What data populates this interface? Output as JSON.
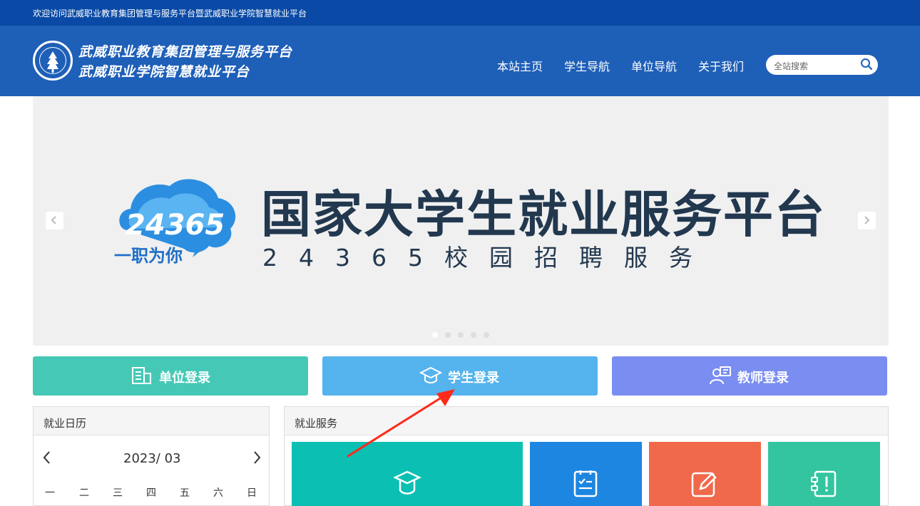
{
  "topbar": {
    "welcome": "欢迎访问武威职业教育集团管理与服务平台暨武威职业学院智慧就业平台"
  },
  "header": {
    "title_line1": "武威职业教育集团管理与服务平台",
    "title_line2": "武威职业学院智慧就业平台",
    "nav": [
      "本站主页",
      "学生导航",
      "单位导航",
      "关于我们"
    ],
    "search_placeholder": "全站搜索"
  },
  "banner": {
    "logo_number": "24365",
    "logo_slogan": "一职为你",
    "title": "国家大学生就业服务平台",
    "subtitle": "24365校园招聘服务",
    "slides": 5,
    "active_slide": 1
  },
  "logins": [
    {
      "label": "单位登录",
      "color": "#45c9b6",
      "icon": "building-icon"
    },
    {
      "label": "学生登录",
      "color": "#55b3ee",
      "icon": "graduation-cap-icon"
    },
    {
      "label": "教师登录",
      "color": "#7a8df0",
      "icon": "teacher-icon"
    }
  ],
  "calendar": {
    "title": "就业日历",
    "month": "2023/ 03",
    "weekdays": [
      "一",
      "二",
      "三",
      "四",
      "五",
      "六",
      "日"
    ]
  },
  "services": {
    "title": "就业服务",
    "tiles": [
      {
        "color": "#0bbfb3",
        "icon": "graduation-cap-icon"
      },
      {
        "color": "#1d86e0",
        "icon": "clipboard-list-icon"
      },
      {
        "color": "#f0694a",
        "icon": "edit-icon"
      },
      {
        "color": "#32c5a0",
        "icon": "checklist-icon"
      }
    ]
  },
  "annotation": {
    "color": "#ff2a1a"
  }
}
